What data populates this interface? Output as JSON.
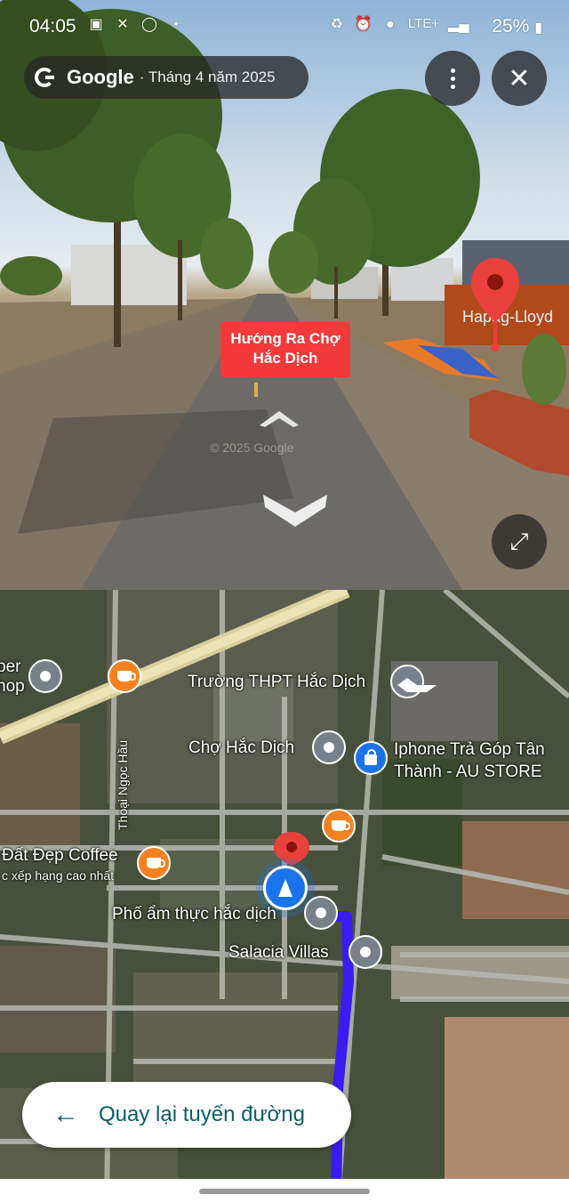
{
  "status_bar": {
    "time": "04:05",
    "battery": "25%",
    "network": "LTE+",
    "icons": [
      "shopping-bag-icon",
      "missed-call-icon",
      "chrome-icon",
      "dot-icon",
      "recycle-icon",
      "alarm-icon",
      "location-icon",
      "lte-icon",
      "signal-icon",
      "battery-icon"
    ]
  },
  "street_view": {
    "brand": "Google",
    "date": "· Tháng 4 năm 2025",
    "place_label_line1": "Hướng Ra Chợ",
    "place_label_line2": "Hắc Dịch",
    "label_color": "#f23a3a",
    "container_text": "Hapag-Lloyd",
    "watermark": "© 2025 Google"
  },
  "map": {
    "labels": {
      "school": "Trường THPT Hắc Dịch",
      "market": "Chợ Hắc Dịch",
      "store_line1": "Iphone Trả Góp Tân",
      "store_line2": "Thành - AU STORE",
      "street": "Thoại Ngọc Hầu",
      "coffee": "Đất Đẹp Coffee",
      "coffee_sub": "c xếp hạng cao nhất",
      "food": "Phố ẩm thực hắc dịch",
      "villas": "Salacia Villas",
      "shop_line1": "per",
      "shop_line2": "hop"
    },
    "route_color": "#3b1bf0",
    "back_button": "Quay lại tuyến đường"
  }
}
